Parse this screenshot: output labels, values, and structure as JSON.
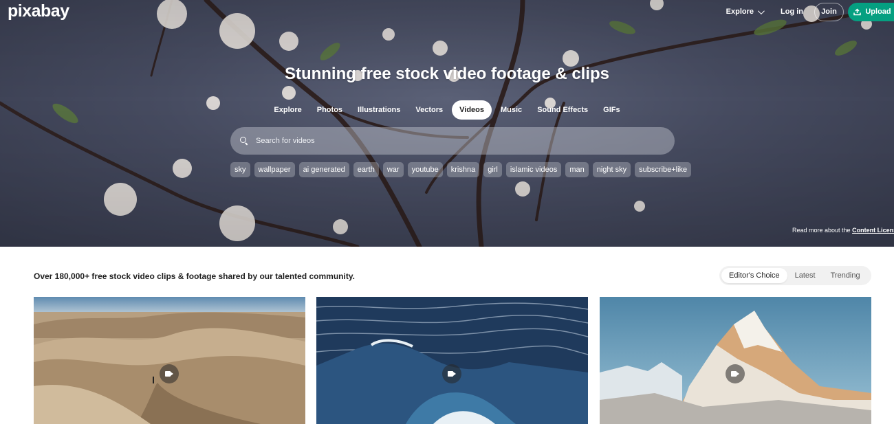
{
  "header": {
    "logo": "pixabay",
    "explore_label": "Explore",
    "login_label": "Log in",
    "join_label": "Join",
    "upload_label": "Upload"
  },
  "hero": {
    "title": "Stunning free stock video footage & clips",
    "media_types": [
      "Explore",
      "Photos",
      "Illustrations",
      "Vectors",
      "Videos",
      "Music",
      "Sound Effects",
      "GIFs"
    ],
    "active_media_type": "Videos",
    "search": {
      "placeholder": "Search for videos",
      "value": ""
    },
    "tags": [
      "sky",
      "wallpaper",
      "ai generated",
      "earth",
      "war",
      "youtube",
      "krishna",
      "girl",
      "islamic videos",
      "man",
      "night sky",
      "subscribe+like"
    ],
    "license_prefix": "Read more about the",
    "license_link": "Content License"
  },
  "main": {
    "intro": "Over 180,000+ free stock video clips & footage shared by our talented community.",
    "sort_tabs": [
      "Editor's Choice",
      "Latest",
      "Trending"
    ],
    "active_sort": "Editor's Choice",
    "videos": [
      {
        "subject": "desert dunes",
        "icon": "video-camera-icon"
      },
      {
        "subject": "ocean waves",
        "icon": "video-camera-icon"
      },
      {
        "subject": "snowy mountain peak",
        "icon": "video-camera-icon"
      }
    ]
  },
  "colors": {
    "brand_green": "#05a081",
    "hero_bg": "#474c61",
    "text_dark": "#1f1f1f"
  }
}
